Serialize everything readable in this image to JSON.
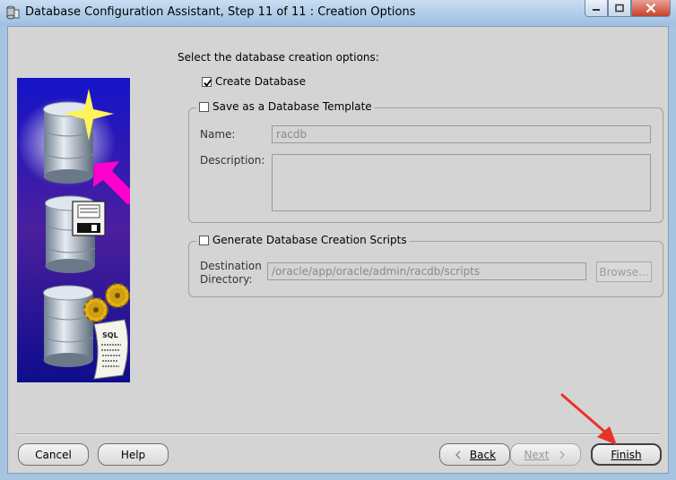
{
  "window": {
    "title": "Database Configuration Assistant, Step 11 of 11 : Creation Options"
  },
  "main": {
    "heading": "Select the database creation options:",
    "create_database": {
      "label": "Create Database",
      "checked": true
    },
    "template_group": {
      "label": "Save as a Database Template",
      "checked": false,
      "name_label": "Name:",
      "name_value": "racdb",
      "description_label": "Description:",
      "description_value": ""
    },
    "scripts_group": {
      "label": "Generate Database Creation Scripts",
      "checked": false,
      "dest_label_line1": "Destination",
      "dest_label_line2": "Directory:",
      "dest_value": "/oracle/app/oracle/admin/racdb/scripts",
      "browse_label": "Browse..."
    }
  },
  "footer": {
    "cancel": "Cancel",
    "help": "Help",
    "back": "Back",
    "next": "Next",
    "finish": "Finish"
  },
  "image": {
    "sql_text": "SQL"
  },
  "colors": {
    "annotation_arrow": "#e8332a",
    "window_frame": "#a6c3e0",
    "panel": "#d4d4d4",
    "magenta_arrow": "#ff00cc"
  }
}
